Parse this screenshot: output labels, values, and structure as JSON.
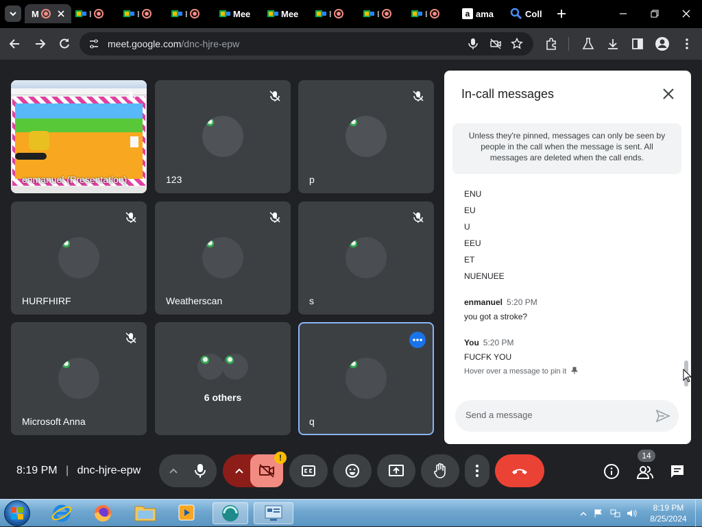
{
  "browser": {
    "tabs": [
      {
        "label": "M",
        "active": true
      },
      {
        "label": "Mee"
      },
      {
        "label": "Mee"
      },
      {
        "label": "ama"
      },
      {
        "label": "Coll"
      }
    ],
    "url_host": "meet.google.com",
    "url_path": "/dnc-hjre-epw"
  },
  "tiles": [
    {
      "name": "enmanuel (Presentation)"
    },
    {
      "name": "123"
    },
    {
      "name": "p"
    },
    {
      "name": "HURFHIRF"
    },
    {
      "name": "Weatherscan"
    },
    {
      "name": "s"
    },
    {
      "name": "Microsoft Anna"
    },
    {
      "name": "6 others"
    },
    {
      "name": "q"
    }
  ],
  "chat": {
    "title": "In-call messages",
    "info": "Unless they're pinned, messages can only be seen by people in the call when the message is sent. All messages are deleted when the call ends.",
    "lines": [
      "ENU",
      "EU",
      "U",
      "EEU",
      "ET",
      "NUENUEE"
    ],
    "messages": [
      {
        "sender": "enmanuel",
        "time": "5:20 PM",
        "text": "you got a stroke?"
      },
      {
        "sender": "You",
        "time": "5:20 PM",
        "text": "FUCFK YOU"
      }
    ],
    "hint": "Hover over a message to pin it",
    "input_placeholder": "Send a message"
  },
  "footer": {
    "time": "8:19 PM",
    "separator": "|",
    "meeting_code": "dnc-hjre-epw",
    "people_count": "14",
    "warning": "!"
  },
  "taskbar": {
    "time": "8:19 PM",
    "date": "8/25/2024"
  },
  "colors": {
    "accent": "#1a73e8",
    "end_call": "#ea4335",
    "camera_off": "#f28b82",
    "background": "#202124",
    "tile": "#3c4043"
  },
  "icons": [
    "chevron-down-icon",
    "meet-icon",
    "record-icon",
    "amazon-icon",
    "search-icon",
    "close-icon",
    "plus-icon",
    "minimize-icon",
    "restore-icon",
    "back-icon",
    "forward-icon",
    "reload-icon",
    "site-info-icon",
    "mic-icon",
    "camera-off-icon",
    "star-icon",
    "extensions-icon",
    "labs-icon",
    "download-icon",
    "side-panel-icon",
    "profile-icon",
    "menu-icon",
    "mic-off-icon",
    "more-options-icon",
    "send-icon",
    "pin-icon",
    "chevron-up-icon",
    "captions-icon",
    "emoji-icon",
    "present-icon",
    "raise-hand-icon",
    "end-call-icon",
    "info-icon",
    "people-icon",
    "chat-icon",
    "windows-start-icon",
    "ie-icon",
    "firefox-icon",
    "explorer-icon",
    "media-player-icon",
    "dxball-icon",
    "control-panel-icon",
    "flag-icon",
    "network-icon",
    "volume-icon"
  ]
}
